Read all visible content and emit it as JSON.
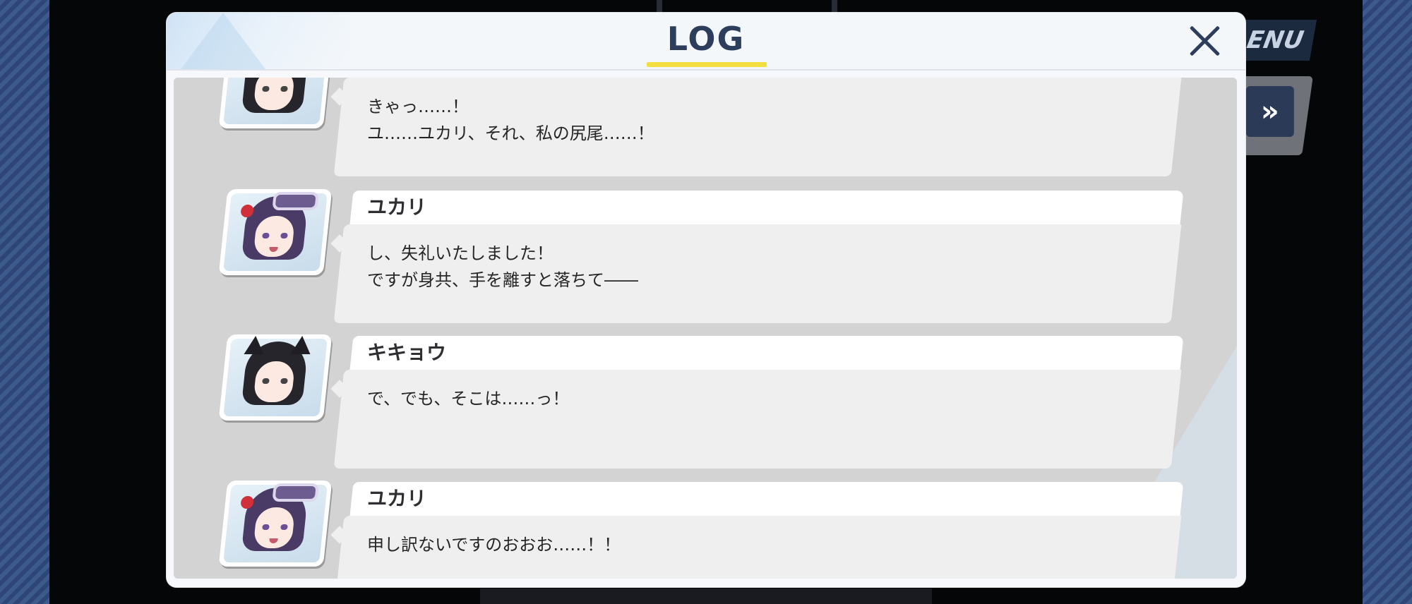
{
  "log": {
    "title": "LOG",
    "close_icon": "close-icon"
  },
  "background": {
    "menu_label": "ENU",
    "fast_forward_label": "»"
  },
  "entries": [
    {
      "speaker": "",
      "lines": "きゃっ……！\nユ……ユカリ、それ、私の尻尾……！",
      "avatar": "kikyou-avatar"
    },
    {
      "speaker": "ユカリ",
      "lines": "し、失礼いたしました！\nですが身共、手を離すと落ちて――",
      "avatar": "yukari-avatar"
    },
    {
      "speaker": "キキョウ",
      "lines": "で、でも、そこは……っ！",
      "avatar": "kikyou-avatar"
    },
    {
      "speaker": "ユカリ",
      "lines": "申し訳ないですのおおお……！！",
      "avatar": "yukari-avatar"
    }
  ],
  "colors": {
    "accent_underline": "#f2df3f",
    "title_color": "#2c3e5c",
    "side_stripe": "#3d5a8c"
  }
}
